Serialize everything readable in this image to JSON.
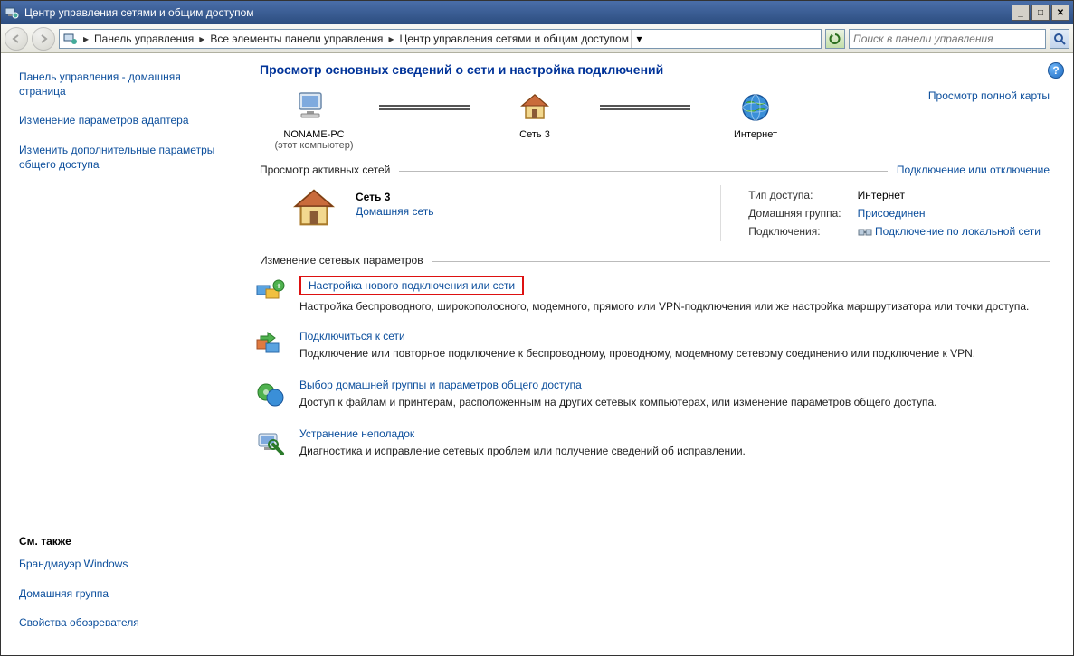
{
  "window": {
    "title": "Центр управления сетями и общим доступом"
  },
  "breadcrumb": {
    "items": [
      "Панель управления",
      "Все элементы панели управления",
      "Центр управления сетями и общим доступом"
    ]
  },
  "search": {
    "placeholder": "Поиск в панели управления"
  },
  "sidebar": {
    "links": [
      "Панель управления - домашняя страница",
      "Изменение параметров адаптера",
      "Изменить дополнительные параметры общего доступа"
    ],
    "seeAlsoHeader": "См. также",
    "seeAlso": [
      "Брандмауэр Windows",
      "Домашняя группа",
      "Свойства обозревателя"
    ]
  },
  "main": {
    "heading": "Просмотр основных сведений о сети и настройка подключений",
    "mapLink": "Просмотр полной карты",
    "mapNodes": {
      "pc": {
        "label": "NONAME-PC",
        "sub": "(этот компьютер)"
      },
      "net": {
        "label": "Сеть  3"
      },
      "internet": {
        "label": "Интернет"
      }
    },
    "activeHeader": "Просмотр активных сетей",
    "activeLink": "Подключение или отключение",
    "activeNet": {
      "name": "Сеть  3",
      "type": "Домашняя сеть",
      "details": {
        "accessLabel": "Тип доступа:",
        "accessValue": "Интернет",
        "homegroupLabel": "Домашняя группа:",
        "homegroupValue": "Присоединен",
        "connectionsLabel": "Подключения:",
        "connectionsValue": "Подключение по локальной сети"
      }
    },
    "changeHeader": "Изменение сетевых параметров",
    "tasks": [
      {
        "title": "Настройка нового подключения или сети",
        "desc": "Настройка беспроводного, широкополосного, модемного, прямого или VPN-подключения или же настройка маршрутизатора или точки доступа."
      },
      {
        "title": "Подключиться к сети",
        "desc": "Подключение или повторное подключение к беспроводному, проводному, модемному сетевому соединению или подключение к VPN."
      },
      {
        "title": "Выбор домашней группы и параметров общего доступа",
        "desc": "Доступ к файлам и принтерам, расположенным на других сетевых компьютерах, или изменение параметров общего доступа."
      },
      {
        "title": "Устранение неполадок",
        "desc": "Диагностика и исправление сетевых проблем или получение сведений об исправлении."
      }
    ]
  }
}
